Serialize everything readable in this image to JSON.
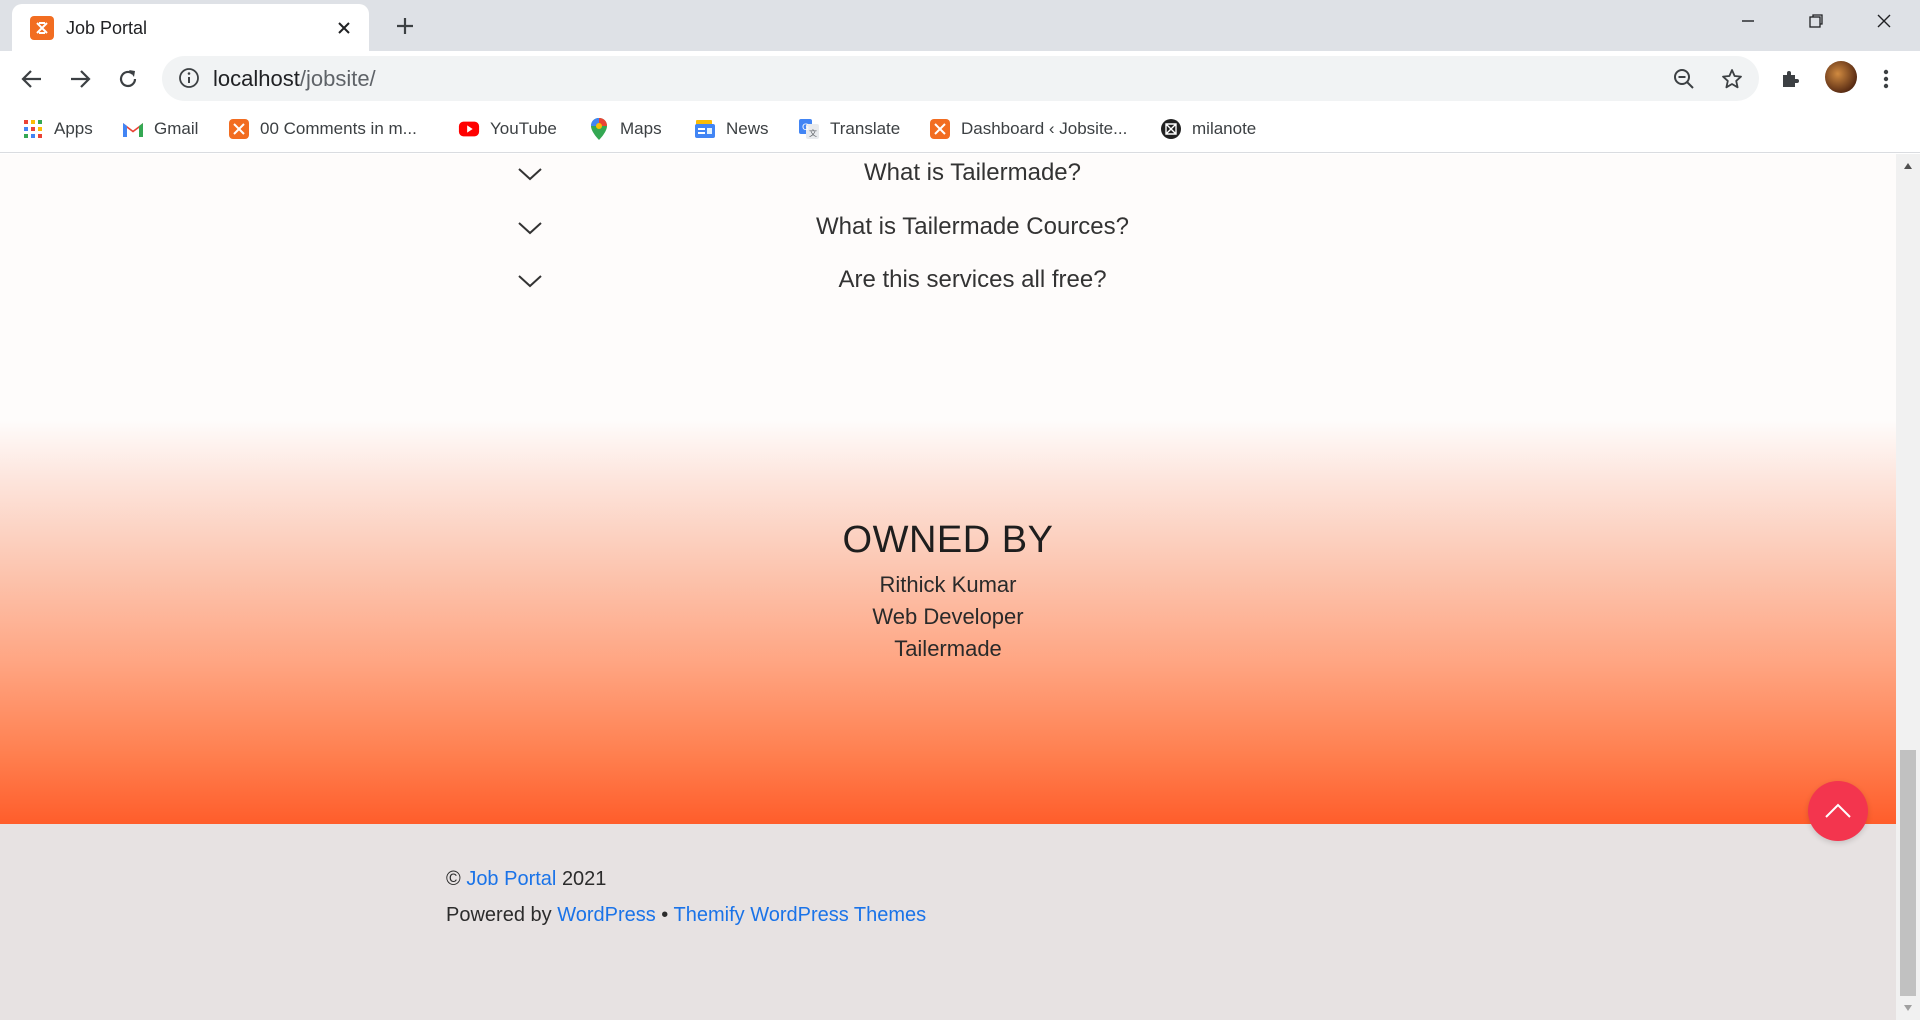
{
  "browser": {
    "tab_title": "Job Portal",
    "url_host": "localhost",
    "url_path": "/jobsite/",
    "bookmarks": [
      {
        "label": "Apps",
        "icon": "apps-grid-icon"
      },
      {
        "label": "Gmail",
        "icon": "gmail-icon"
      },
      {
        "label": "00 Comments in m...",
        "icon": "xampp-icon"
      },
      {
        "label": "YouTube",
        "icon": "youtube-icon"
      },
      {
        "label": "Maps",
        "icon": "maps-icon"
      },
      {
        "label": "News",
        "icon": "news-icon"
      },
      {
        "label": "Translate",
        "icon": "translate-icon"
      },
      {
        "label": "Dashboard ‹ Jobsite...",
        "icon": "xampp-icon"
      },
      {
        "label": "milanote",
        "icon": "milanote-icon"
      }
    ]
  },
  "faq": {
    "items": [
      {
        "question": "What is Tailermade?"
      },
      {
        "question": "What is Tailermade Cources?"
      },
      {
        "question": "Are this services all free?"
      }
    ]
  },
  "owned": {
    "title": "OWNED BY",
    "name": "Rithick Kumar",
    "role": "Web Developer",
    "company": "Tailermade"
  },
  "footer": {
    "copyright_symbol": "©",
    "site_link": "Job Portal",
    "year": "2021",
    "powered_prefix": "Powered by",
    "wordpress_link": "WordPress",
    "separator": "•",
    "themify_link": "Themify WordPress Themes"
  },
  "colors": {
    "accent_link": "#1a73e8",
    "back_to_top": "#f3354e",
    "gradient_bottom": "#ff5d2b",
    "xampp_orange": "#f26d21"
  }
}
